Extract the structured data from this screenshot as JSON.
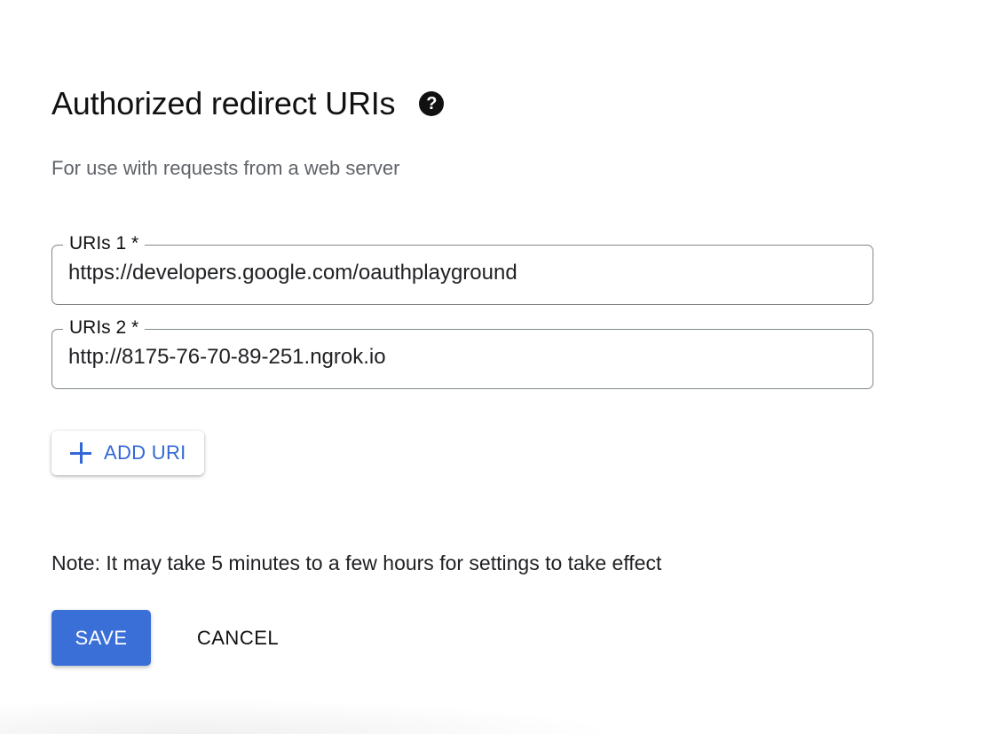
{
  "section": {
    "title": "Authorized redirect URIs",
    "help_icon_glyph": "?",
    "help_icon_name": "question-circle-icon",
    "subtitle": "For use with requests from a web server"
  },
  "uris": [
    {
      "label": "URIs 1 *",
      "value": "https://developers.google.com/oauthplayground"
    },
    {
      "label": "URIs 2 *",
      "value": "http://8175-76-70-89-251.ngrok.io"
    }
  ],
  "add_uri": {
    "label": "ADD URI",
    "icon_name": "plus-icon"
  },
  "note": "Note: It may take 5 minutes to a few hours for settings to take effect",
  "actions": {
    "save_label": "SAVE",
    "cancel_label": "CANCEL"
  },
  "colors": {
    "accent": "#3a6fd8",
    "link_blue": "#3367d6",
    "border": "#80868b",
    "text_primary": "#202124",
    "text_secondary": "#5f6368"
  }
}
